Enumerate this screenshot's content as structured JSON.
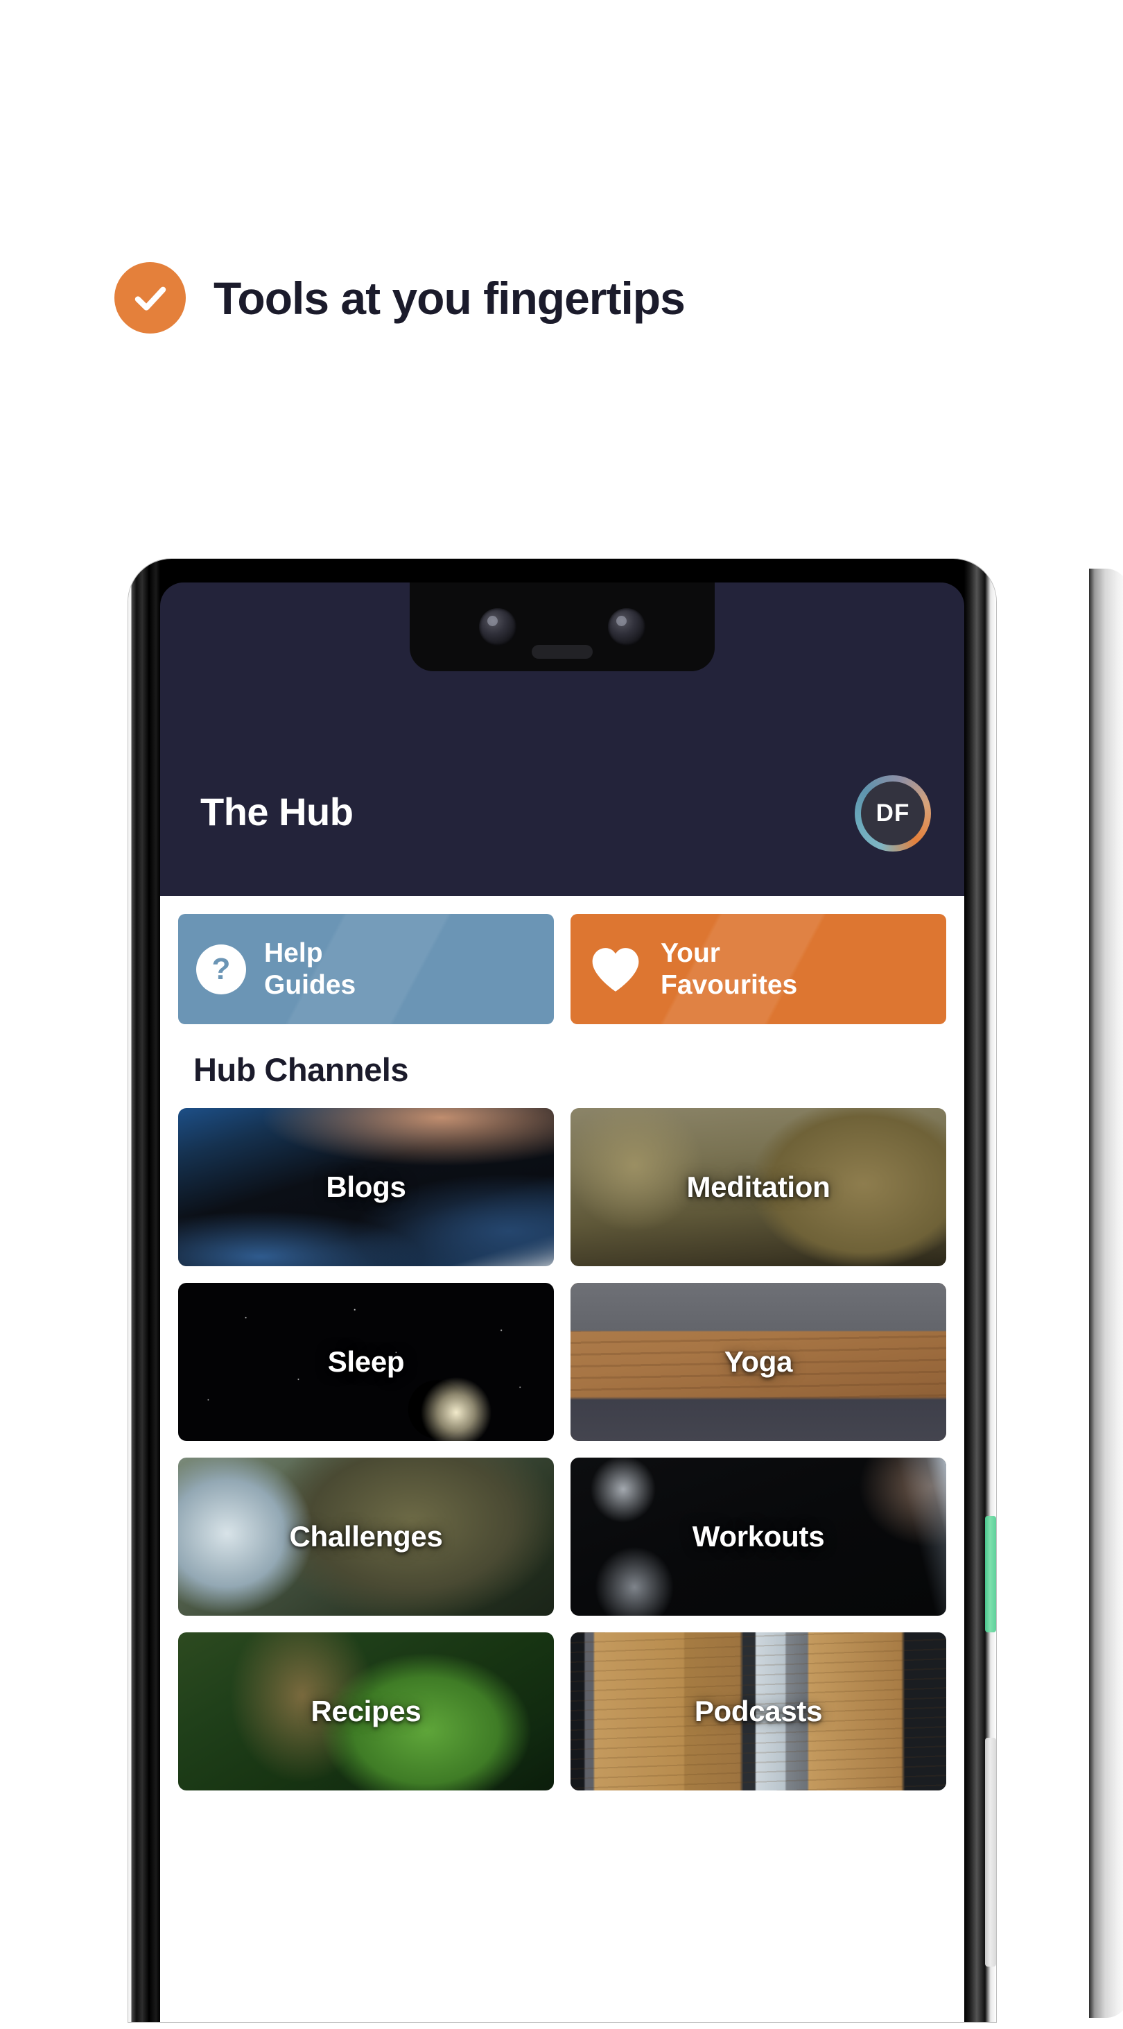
{
  "theme": {
    "accent_orange": "#E4803B",
    "tile_blue": "#6B95B5",
    "tile_orange": "#DD7631",
    "header_dark": "#23233A",
    "text_dark": "#1B1B2B"
  },
  "headline": {
    "text": "Tools at you fingertips",
    "badge_icon": "check-circle-icon"
  },
  "phone": {
    "power_button": "power-button",
    "volume_button": "volume-rocker-button",
    "front_camera": "front-camera-lens",
    "secondary_camera": "secondary-camera-lens",
    "earpiece": "earpiece-speaker"
  },
  "app": {
    "header": {
      "title": "The Hub",
      "avatar_initials": "DF"
    },
    "quick_actions": [
      {
        "label_line1": "Help",
        "label_line2": "Guides",
        "icon": "question-mark-icon",
        "color": "#6B95B5"
      },
      {
        "label_line1": "Your",
        "label_line2": "Favourites",
        "icon": "heart-icon",
        "color": "#DD7631"
      }
    ],
    "section_title": "Hub Channels",
    "channels": [
      {
        "label": "Blogs",
        "image": "person-in-denim-photo"
      },
      {
        "label": "Meditation",
        "image": "singing-bowls-photo"
      },
      {
        "label": "Sleep",
        "image": "crescent-moon-night-sky-photo"
      },
      {
        "label": "Yoga",
        "image": "laptop-on-wooden-desk-photo"
      },
      {
        "label": "Challenges",
        "image": "coastal-rocks-waves-photo"
      },
      {
        "label": "Workouts",
        "image": "dark-gym-equipment-photo"
      },
      {
        "label": "Recipes",
        "image": "green-vegetables-photo"
      },
      {
        "label": "Podcasts",
        "image": "wooden-panels-photo"
      }
    ]
  }
}
